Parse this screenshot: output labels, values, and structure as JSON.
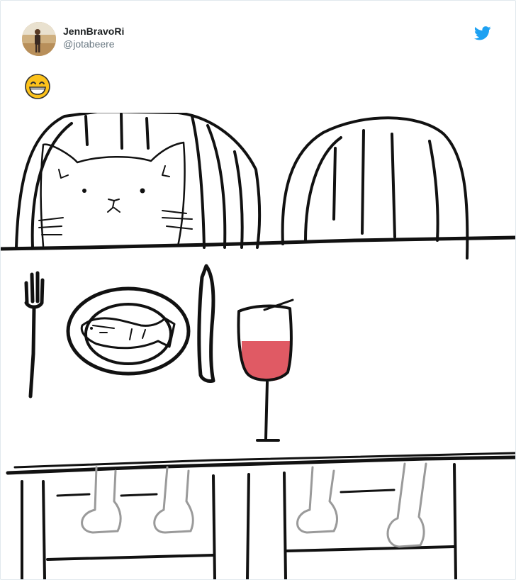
{
  "user": {
    "display_name": "JennBravoRi",
    "handle": "@jotabeere",
    "avatar_icon": "user-avatar-photo"
  },
  "brand": {
    "icon": "twitter-bird-icon",
    "color": "#1da1f2"
  },
  "tweet": {
    "emoji_icon": "grinning-face-with-smiling-eyes-emoji"
  },
  "colors": {
    "wine": "#e05a64",
    "ink": "#111111",
    "emoji": "#fcc21b"
  }
}
